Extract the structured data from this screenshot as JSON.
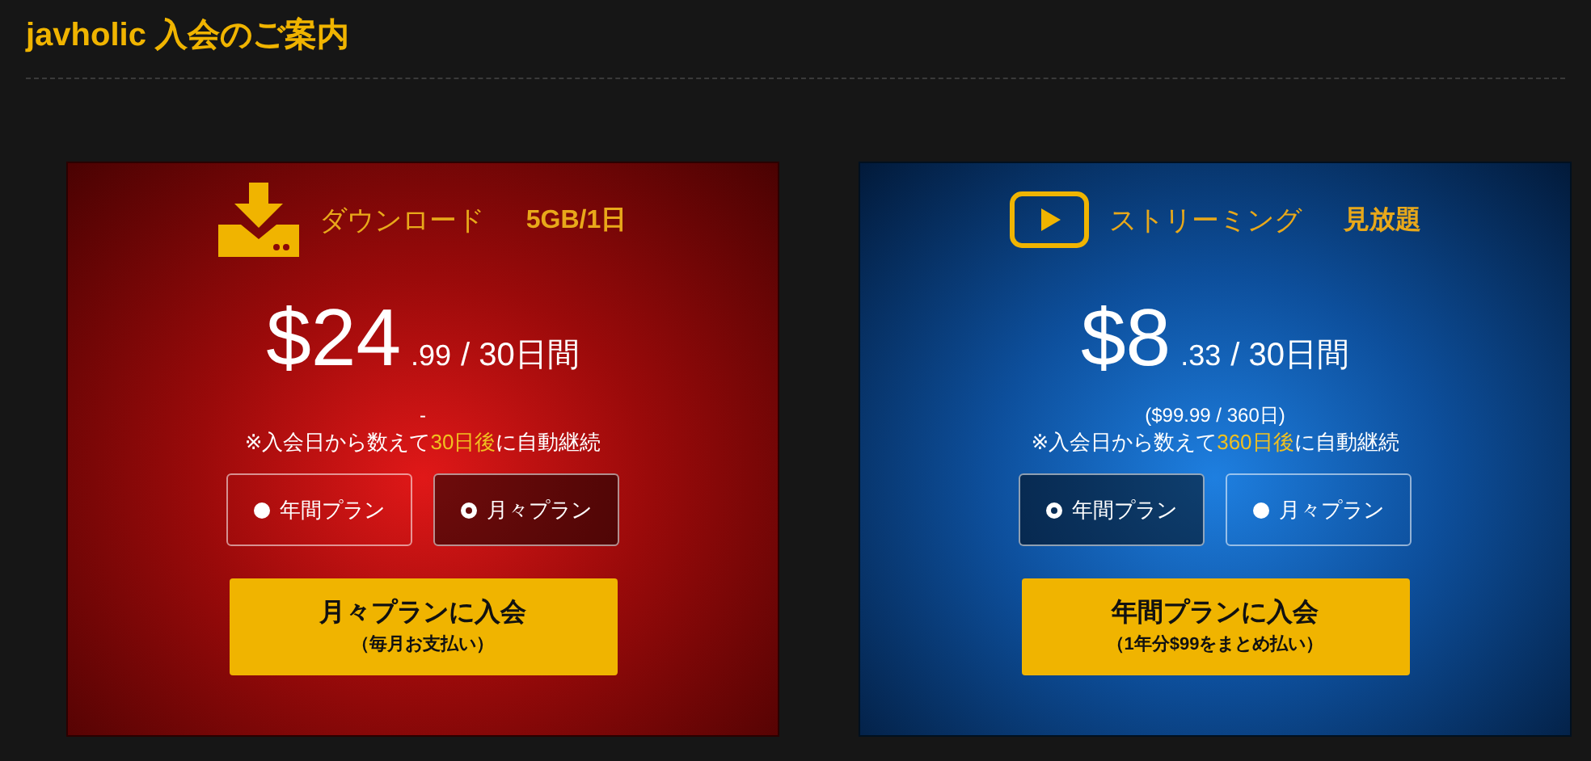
{
  "page_title": "javholic 入会のご案内",
  "plans": [
    {
      "kind": "download",
      "name": "ダウンロード",
      "quota": "5GB/1日",
      "price_main": "$24",
      "price_cents": ".99",
      "price_period": "/ 30日間",
      "sub_note": "-",
      "renewal_note": "※入会日から数えて**30日後**に自動継続",
      "options": [
        {
          "label": "年間プラン",
          "selected": false
        },
        {
          "label": "月々プラン",
          "selected": true
        }
      ],
      "join_button": {
        "label": "月々プランに入会",
        "sub": "（毎月お支払い）"
      }
    },
    {
      "kind": "streaming",
      "name": "ストリーミング",
      "quota": "見放題",
      "price_main": "$8",
      "price_cents": ".33",
      "price_period": "/ 30日間",
      "sub_note": "($99.99 / 360日)",
      "renewal_note": "※入会日から数えて**360日後**に自動継続",
      "options": [
        {
          "label": "年間プラン",
          "selected": true
        },
        {
          "label": "月々プラン",
          "selected": false
        }
      ],
      "join_button": {
        "label": "年間プランに入会",
        "sub": "（1年分$99をまとめ払い）"
      }
    }
  ]
}
